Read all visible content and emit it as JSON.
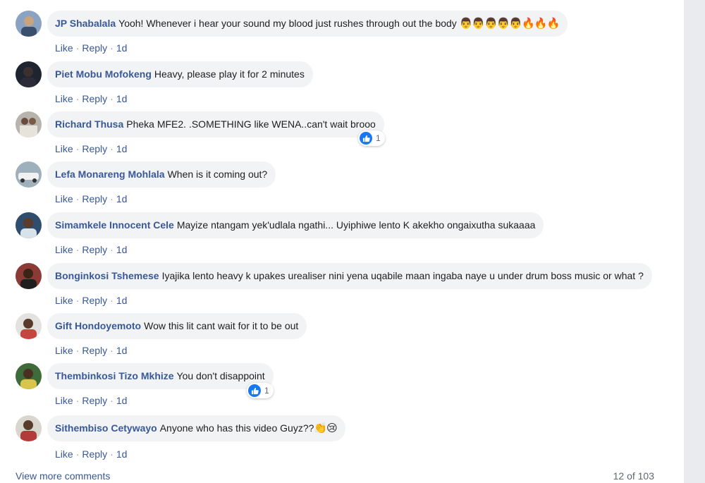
{
  "comments": [
    {
      "author": "JP Shabalala",
      "text": "Yooh! Whenever i hear your sound my blood just rushes through out the body",
      "emoji": "👨👨👨👨👨🔥🔥🔥",
      "like": "Like",
      "reply": "Reply",
      "time": "1d"
    },
    {
      "author": "Piet Mobu Mofokeng",
      "text": "Heavy, please play it for 2 minutes",
      "like": "Like",
      "reply": "Reply",
      "time": "1d"
    },
    {
      "author": "Richard Thusa",
      "text": "Pheka MFE2. .SOMETHING like WENA..can't wait brooo",
      "like": "Like",
      "reply": "Reply",
      "time": "1d",
      "reaction_count": "1"
    },
    {
      "author": "Lefa Monareng Mohlala",
      "text": "When is it coming out?",
      "like": "Like",
      "reply": "Reply",
      "time": "1d"
    },
    {
      "author": "Simamkele Innocent Cele",
      "text": "Mayize ntangam yek'udlala ngathi... Uyiphiwe lento K akekho ongaixutha sukaaaa",
      "like": "Like",
      "reply": "Reply",
      "time": "1d"
    },
    {
      "author": "Bonginkosi Tshemese",
      "text": "Iyajika lento heavy k upakes urealiser nini yena uqabile maan ingaba naye u under drum boss music or what ?",
      "like": "Like",
      "reply": "Reply",
      "time": "1d"
    },
    {
      "author": "Gift Hondoyemoto",
      "text": "Wow this lit cant wait for it to be out",
      "like": "Like",
      "reply": "Reply",
      "time": "1d"
    },
    {
      "author": "Thembinkosi Tizo Mkhize",
      "text": "You don't disappoint",
      "like": "Like",
      "reply": "Reply",
      "time": "1d",
      "reaction_count": "1"
    },
    {
      "author": "Sithembiso Cetywayo",
      "text": "Anyone who has this video Guyz??",
      "emoji": "👏😢",
      "like": "Like",
      "reply": "Reply",
      "time": "1d"
    }
  ],
  "footer": {
    "view_more": "View more comments",
    "count": "12 of 103"
  },
  "colors": {
    "author": "#385898",
    "bubble": "#f2f3f5",
    "like_blue": "#1877f2"
  },
  "icons": {
    "reaction": "like-thumb-icon"
  }
}
